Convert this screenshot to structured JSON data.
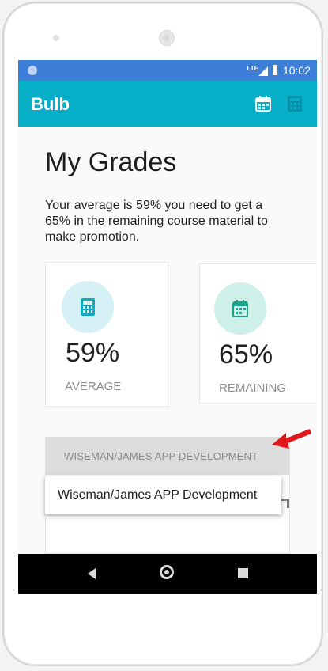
{
  "status_bar": {
    "network": "LTE",
    "time": "10:02"
  },
  "app_bar": {
    "title": "Bulb",
    "icons": [
      "calendar-icon",
      "calculator-icon"
    ]
  },
  "page": {
    "title": "My Grades",
    "subtitle": "Your average is 59% you need to get a 65% in the remaining course material to make promotion."
  },
  "cards": [
    {
      "icon": "calculator-icon",
      "value": "59%",
      "label": "AVERAGE"
    },
    {
      "icon": "calendar-icon",
      "value": "65%",
      "label": "REMAINING"
    }
  ],
  "course_dropdown": {
    "selected": "WISEMAN/JAMES APP DEVELOPMENT"
  },
  "dropdown_menu": {
    "items": [
      "Wiseman/James APP Development"
    ]
  },
  "nav_bar": {
    "buttons": [
      "back",
      "home",
      "recents"
    ]
  },
  "colors": {
    "status_bar": "#3d7ed8",
    "app_bar": "#06afc7",
    "annotation_arrow": "#e0181b"
  }
}
